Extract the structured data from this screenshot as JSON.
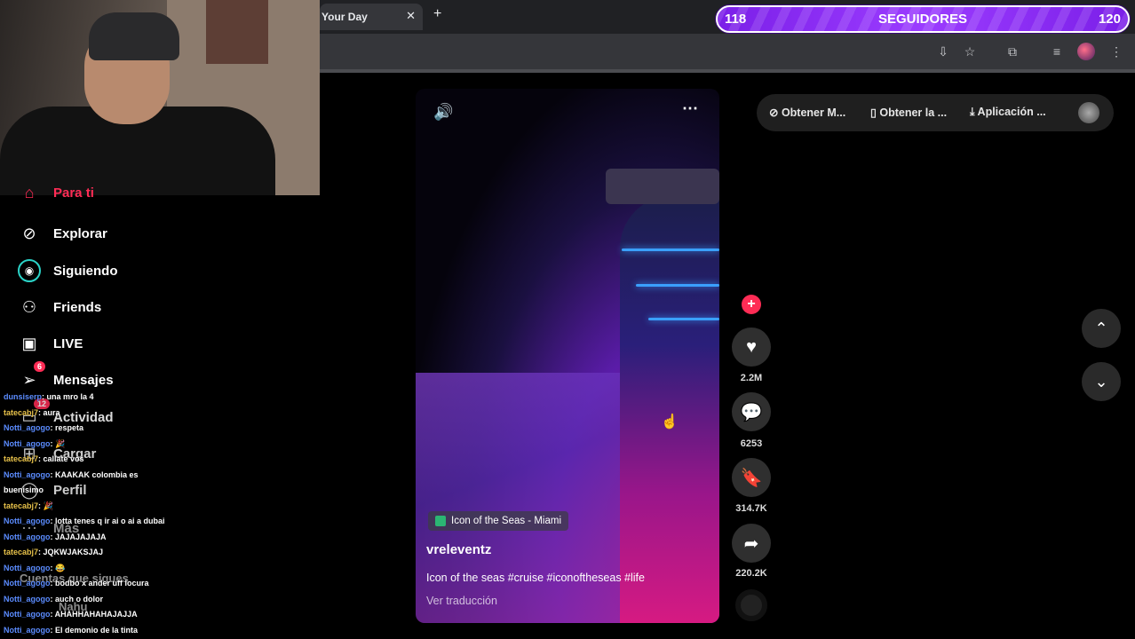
{
  "browser": {
    "tab_title": "Your Day",
    "tab_close": "✕",
    "new_tab": "+",
    "toolbar_icons": [
      "install-icon",
      "star-icon",
      "extensions-icon",
      "media-icon",
      "profile-avatar",
      "menu-icon"
    ]
  },
  "follower_bar": {
    "current": "118",
    "label": "SEGUIDORES",
    "goal": "120"
  },
  "sidebar": {
    "items": [
      {
        "label": "Para ti",
        "icon": "home-icon"
      },
      {
        "label": "Explorar",
        "icon": "compass-icon"
      },
      {
        "label": "Siguiendo",
        "icon": "following-avatar-icon"
      },
      {
        "label": "Friends",
        "icon": "friends-icon"
      },
      {
        "label": "LIVE",
        "icon": "live-tv-icon"
      },
      {
        "label": "Mensajes",
        "icon": "send-icon",
        "badge": "6"
      },
      {
        "label": "Actividad",
        "icon": "inbox-icon",
        "badge": "12"
      },
      {
        "label": "Cargar",
        "icon": "upload-icon"
      },
      {
        "label": "Perfil",
        "icon": "profile-icon"
      },
      {
        "label": "Más",
        "icon": "more-icon"
      }
    ],
    "following_header": "Cuentas que sigues",
    "following_user": "Nahu"
  },
  "chat": [
    {
      "user": "dunsiserp",
      "text": ": una mro la 4",
      "alt": false
    },
    {
      "user": "tatecabj7",
      "text": ": aura",
      "alt": true
    },
    {
      "user": "Notti_agogo",
      "text": ": respeta",
      "alt": false
    },
    {
      "user": "Notti_agogo",
      "text": ": 🎉",
      "alt": false
    },
    {
      "user": "tatecabj7",
      "text": ": callate vos",
      "alt": true
    },
    {
      "user": "Notti_agogo",
      "text": ": KAAKAK colombia es",
      "alt": false
    },
    {
      "user": "",
      "text": "buenisimo",
      "alt": false
    },
    {
      "user": "tatecabj7",
      "text": ": 🎉",
      "alt": true
    },
    {
      "user": "Notti_agogo",
      "text": ": lotta tenes q ir ai o ai a dubai",
      "alt": false
    },
    {
      "user": "Notti_agogo",
      "text": ": JAJAJAJAJA",
      "alt": false
    },
    {
      "user": "tatecabj7",
      "text": ": JQKWJAKSJAJ",
      "alt": true
    },
    {
      "user": "Notti_agogo",
      "text": ": 😂",
      "alt": false
    },
    {
      "user": "Notti_agogo",
      "text": ": bodbo x ander uff locura",
      "alt": false
    },
    {
      "user": "Notti_agogo",
      "text": ": auch o dolor",
      "alt": false
    },
    {
      "user": "Notti_agogo",
      "text": ": AHAHHAHAHAJAJJA",
      "alt": false
    },
    {
      "user": "Notti_agogo",
      "text": ": El demonio de la tinta",
      "alt": false
    }
  ],
  "video": {
    "location": "Icon of the Seas - Miami",
    "author": "vreleventz",
    "caption": "Icon of the seas #cruise #iconoftheseas #life",
    "translate": "Ver traducción"
  },
  "actions": {
    "likes": "2.2M",
    "comments": "6253",
    "saves": "314.7K",
    "shares": "220.2K"
  },
  "top_pill": {
    "item1": "Obtener M...",
    "item2": "Obtener la ...",
    "item3": "Aplicación ..."
  }
}
